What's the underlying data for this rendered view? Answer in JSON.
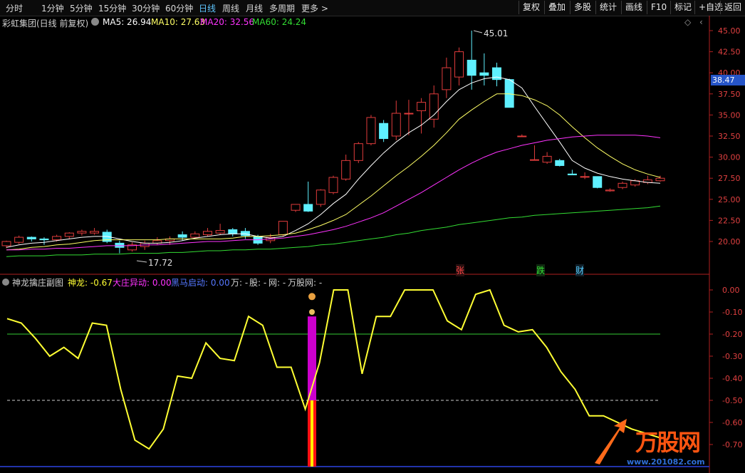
{
  "toolbar": {
    "tabs": [
      "分时",
      "1分钟",
      "5分钟",
      "15分钟",
      "30分钟",
      "60分钟",
      "日线",
      "周线",
      "月线",
      "多周期",
      "更多 >"
    ],
    "active_tab": "日线",
    "buttons": [
      "复权",
      "叠加",
      "多股",
      "统计",
      "画线",
      "F10",
      "标记",
      "+自选",
      "返回"
    ]
  },
  "main_info": {
    "title": "彩虹集团(日线 前复权)",
    "ma5": "MA5: 26.94",
    "ma10": "MA10: 27.63",
    "ma20": "MA20: 32.56",
    "ma60": "MA60: 24.24"
  },
  "main_axis": {
    "ticks": [
      "45.00",
      "42.50",
      "40.00",
      "37.50",
      "35.00",
      "32.50",
      "30.00",
      "27.50",
      "25.00",
      "22.50",
      "20.00"
    ],
    "current_price": "38.47",
    "high_label": "45.01",
    "low_label": "17.72"
  },
  "markers": {
    "zhang": "张",
    "die": "跌",
    "cai": "财"
  },
  "sub_info": {
    "title": "神龙擒庄副图",
    "shenlong": "神龙: -0.67",
    "dazhuang": "大庄异动: 0.00",
    "heima": "黑马启动: 0.00",
    "wan": "万: -",
    "gu": "股: -",
    "wang": "网: -",
    "wangguwang": "万股网: -"
  },
  "sub_axis": {
    "ticks": [
      "0.00",
      "-0.10",
      "-0.20",
      "-0.30",
      "-0.40",
      "-0.50",
      "-0.60",
      "-0.70"
    ]
  },
  "watermark": {
    "logo": "万股网",
    "url": "www.201082.com"
  },
  "colors": {
    "up": "#e03c3c",
    "down": "#5ff0ff",
    "ma5": "#ffffff",
    "ma10": "#ffff66",
    "ma20": "#ff33ff",
    "ma60": "#33dd33",
    "shenlong": "#ffff33"
  },
  "chart_data": [
    {
      "type": "candlestick",
      "title": "彩虹集团(日线 前复权)",
      "ylim": [
        17.5,
        46.0
      ],
      "candles": [
        [
          19.5,
          20.0,
          19.2,
          20.1
        ],
        [
          19.9,
          20.5,
          19.7,
          20.7
        ],
        [
          20.5,
          20.3,
          20.0,
          20.6
        ],
        [
          20.3,
          20.2,
          19.6,
          20.5
        ],
        [
          20.2,
          20.6,
          20.0,
          20.8
        ],
        [
          20.6,
          21.0,
          20.3,
          21.1
        ],
        [
          21.0,
          21.2,
          20.7,
          21.4
        ],
        [
          21.0,
          21.2,
          20.8,
          21.6
        ],
        [
          21.1,
          20.0,
          19.8,
          21.4
        ],
        [
          19.8,
          19.3,
          18.6,
          20.1
        ],
        [
          19.0,
          19.6,
          18.8,
          19.9
        ],
        [
          19.4,
          19.8,
          19.0,
          20.1
        ],
        [
          19.8,
          20.1,
          19.6,
          20.5
        ],
        [
          20.1,
          20.3,
          19.6,
          20.6
        ],
        [
          20.8,
          20.5,
          20.1,
          21.2
        ],
        [
          20.5,
          20.9,
          20.3,
          21.2
        ],
        [
          20.8,
          21.2,
          20.6,
          21.6
        ],
        [
          21.0,
          21.3,
          20.8,
          22.1
        ],
        [
          21.4,
          20.9,
          20.6,
          21.6
        ],
        [
          21.2,
          20.7,
          20.3,
          21.6
        ],
        [
          20.6,
          19.8,
          19.6,
          20.8
        ],
        [
          20.1,
          20.5,
          19.8,
          20.9
        ],
        [
          20.8,
          22.4,
          20.6,
          22.4
        ],
        [
          23.7,
          24.4,
          23.5,
          24.4
        ],
        [
          24.4,
          23.6,
          23.5,
          27.1
        ],
        [
          24.4,
          26.1,
          24.1,
          26.2
        ],
        [
          25.8,
          27.6,
          25.6,
          27.8
        ],
        [
          27.4,
          29.6,
          27.2,
          30.3
        ],
        [
          29.6,
          31.6,
          29.3,
          31.8
        ],
        [
          31.6,
          34.7,
          31.4,
          35.0
        ],
        [
          34.0,
          32.2,
          31.8,
          34.4
        ],
        [
          32.5,
          35.2,
          32.0,
          36.7
        ],
        [
          35.2,
          35.2,
          32.6,
          36.8
        ],
        [
          35.5,
          36.5,
          32.8,
          37.0
        ],
        [
          34.5,
          37.5,
          33.5,
          38.5
        ],
        [
          38.0,
          40.6,
          37.0,
          41.8
        ],
        [
          39.5,
          42.5,
          38.5,
          43.0
        ],
        [
          41.5,
          39.7,
          38.0,
          45.0
        ],
        [
          40.0,
          39.7,
          38.5,
          42.3
        ],
        [
          40.6,
          39.2,
          38.4,
          41.2
        ],
        [
          39.2,
          35.9,
          35.9,
          39.3
        ],
        [
          32.5,
          32.5,
          32.4,
          32.7
        ],
        [
          29.7,
          29.7,
          29.6,
          31.4
        ],
        [
          29.4,
          30.1,
          29.2,
          30.6
        ],
        [
          29.6,
          29.0,
          28.9,
          29.8
        ],
        [
          28.0,
          27.9,
          27.9,
          28.5
        ],
        [
          27.7,
          27.7,
          27.4,
          28.2
        ],
        [
          27.7,
          26.4,
          26.3,
          27.7
        ],
        [
          26.0,
          26.1,
          25.9,
          26.3
        ],
        [
          26.4,
          26.9,
          26.2,
          27.1
        ],
        [
          26.7,
          27.2,
          26.5,
          27.4
        ],
        [
          27.0,
          27.3,
          26.8,
          27.8
        ],
        [
          27.2,
          27.5,
          27.1,
          27.8
        ]
      ],
      "ma_series": [
        {
          "name": "MA5",
          "values": [
            19.3,
            19.6,
            19.8,
            19.9,
            20.1,
            20.3,
            20.5,
            20.6,
            20.6,
            20.3,
            20.0,
            19.8,
            19.8,
            19.9,
            20.1,
            20.4,
            20.6,
            20.8,
            20.9,
            20.9,
            20.6,
            20.4,
            20.6,
            21.3,
            22.1,
            23.2,
            24.5,
            25.6,
            27.4,
            29.0,
            30.5,
            31.8,
            32.9,
            33.8,
            35.0,
            36.6,
            38.0,
            38.8,
            39.3,
            39.5,
            39.2,
            38.2,
            36.0,
            33.9,
            31.8,
            29.6,
            28.7,
            28.1,
            27.7,
            27.4,
            27.2,
            27.0,
            26.9
          ]
        },
        {
          "name": "MA10",
          "values": [
            19.0,
            19.1,
            19.3,
            19.4,
            19.6,
            19.7,
            19.9,
            20.1,
            20.2,
            20.2,
            20.2,
            20.2,
            20.2,
            20.3,
            20.3,
            20.3,
            20.3,
            20.3,
            20.4,
            20.6,
            20.6,
            20.7,
            20.8,
            21.0,
            21.4,
            21.9,
            22.5,
            23.2,
            24.3,
            25.4,
            26.6,
            27.8,
            28.9,
            30.1,
            31.4,
            32.9,
            34.5,
            35.6,
            36.6,
            37.5,
            37.5,
            37.3,
            36.8,
            36.1,
            35.0,
            33.6,
            32.3,
            31.1,
            30.1,
            29.2,
            28.5,
            28.0,
            27.6
          ]
        },
        {
          "name": "MA20",
          "values": [
            19.0,
            19.0,
            19.1,
            19.1,
            19.2,
            19.2,
            19.3,
            19.4,
            19.5,
            19.5,
            19.5,
            19.6,
            19.6,
            19.7,
            19.8,
            19.9,
            20.0,
            20.0,
            20.1,
            20.2,
            20.2,
            20.3,
            20.4,
            20.6,
            20.8,
            21.1,
            21.4,
            21.8,
            22.3,
            22.8,
            23.4,
            24.2,
            25.0,
            25.8,
            26.7,
            27.6,
            28.5,
            29.3,
            30.0,
            30.6,
            31.0,
            31.4,
            31.7,
            32.0,
            32.2,
            32.4,
            32.5,
            32.6,
            32.6,
            32.6,
            32.6,
            32.5,
            32.3
          ]
        },
        {
          "name": "MA60",
          "values": [
            18.2,
            18.3,
            18.3,
            18.3,
            18.4,
            18.4,
            18.4,
            18.5,
            18.5,
            18.5,
            18.6,
            18.6,
            18.6,
            18.7,
            18.7,
            18.8,
            18.9,
            18.9,
            19.0,
            19.0,
            19.1,
            19.1,
            19.2,
            19.3,
            19.4,
            19.6,
            19.7,
            19.9,
            20.1,
            20.3,
            20.5,
            20.8,
            21.0,
            21.3,
            21.5,
            21.7,
            22.0,
            22.2,
            22.4,
            22.6,
            22.8,
            22.9,
            23.1,
            23.2,
            23.3,
            23.4,
            23.5,
            23.6,
            23.7,
            23.8,
            23.9,
            24.0,
            24.2
          ]
        }
      ]
    },
    {
      "type": "line",
      "title": "神龙擒庄副图",
      "ylim": [
        -0.78,
        0.03
      ],
      "series": [
        {
          "name": "神龙",
          "values": [
            -0.13,
            -0.15,
            -0.22,
            -0.3,
            -0.26,
            -0.31,
            -0.15,
            -0.16,
            -0.45,
            -0.68,
            -0.72,
            -0.63,
            -0.39,
            -0.4,
            -0.24,
            -0.31,
            -0.32,
            -0.12,
            -0.16,
            -0.35,
            -0.35,
            -0.54,
            -0.33,
            0.0,
            0.0,
            -0.38,
            -0.12,
            -0.12,
            0.0,
            0.0,
            0.0,
            -0.14,
            -0.18,
            -0.02,
            0.0,
            -0.16,
            -0.19,
            -0.18,
            -0.26,
            -0.37,
            -0.45,
            -0.57,
            -0.57,
            -0.6,
            -0.63,
            -0.65,
            -0.67
          ]
        },
        {
          "name": "ref_line",
          "values": [
            -0.2
          ]
        },
        {
          "name": "dash_line",
          "values": [
            -0.5
          ]
        }
      ],
      "signal_bar_value": -0.12
    }
  ]
}
